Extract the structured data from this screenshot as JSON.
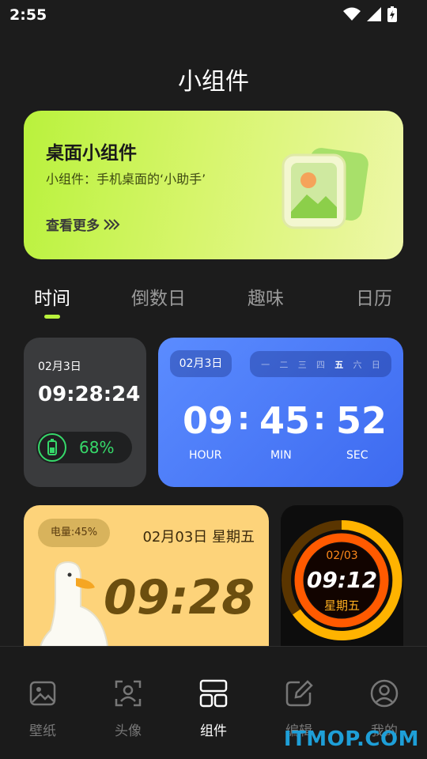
{
  "status_bar": {
    "time": "2:55"
  },
  "page": {
    "title": "小组件"
  },
  "banner": {
    "title": "桌面小组件",
    "subtitle": "小组件：手机桌面的‘小助手’",
    "more": "查看更多"
  },
  "tabs": [
    {
      "label": "时间",
      "active": true
    },
    {
      "label": "倒数日"
    },
    {
      "label": "趣味"
    },
    {
      "label": "日历"
    }
  ],
  "widget_dark": {
    "date": "02月3日",
    "time": "09:28:24",
    "battery": "68%"
  },
  "widget_blue": {
    "date": "02月3日",
    "weekdays": [
      "一",
      "二",
      "三",
      "四",
      "五",
      "六",
      "日"
    ],
    "active_weekday": "五",
    "hour": "09",
    "min": "45",
    "sec": "52",
    "hour_label": "HOUR",
    "min_label": "MIN",
    "sec_label": "SEC"
  },
  "widget_yellow": {
    "battery": "电量:45%",
    "date": "02月03日 星期五",
    "time": "09:28"
  },
  "widget_ring": {
    "date": "02/03",
    "time": "09:12",
    "weekday": "星期五"
  },
  "bottom_nav": [
    {
      "label": "壁纸",
      "icon": "image-icon"
    },
    {
      "label": "头像",
      "icon": "avatar-frame-icon"
    },
    {
      "label": "组件",
      "icon": "widgets-icon",
      "active": true
    },
    {
      "label": "编辑",
      "icon": "edit-icon"
    },
    {
      "label": "我的",
      "icon": "profile-icon"
    }
  ],
  "watermark": "ITMOP.COM",
  "colors": {
    "accent": "#b9f23c",
    "battery_green": "#36d96a",
    "blue_card": "#4a78f5",
    "yellow_card": "#fdd37a"
  }
}
